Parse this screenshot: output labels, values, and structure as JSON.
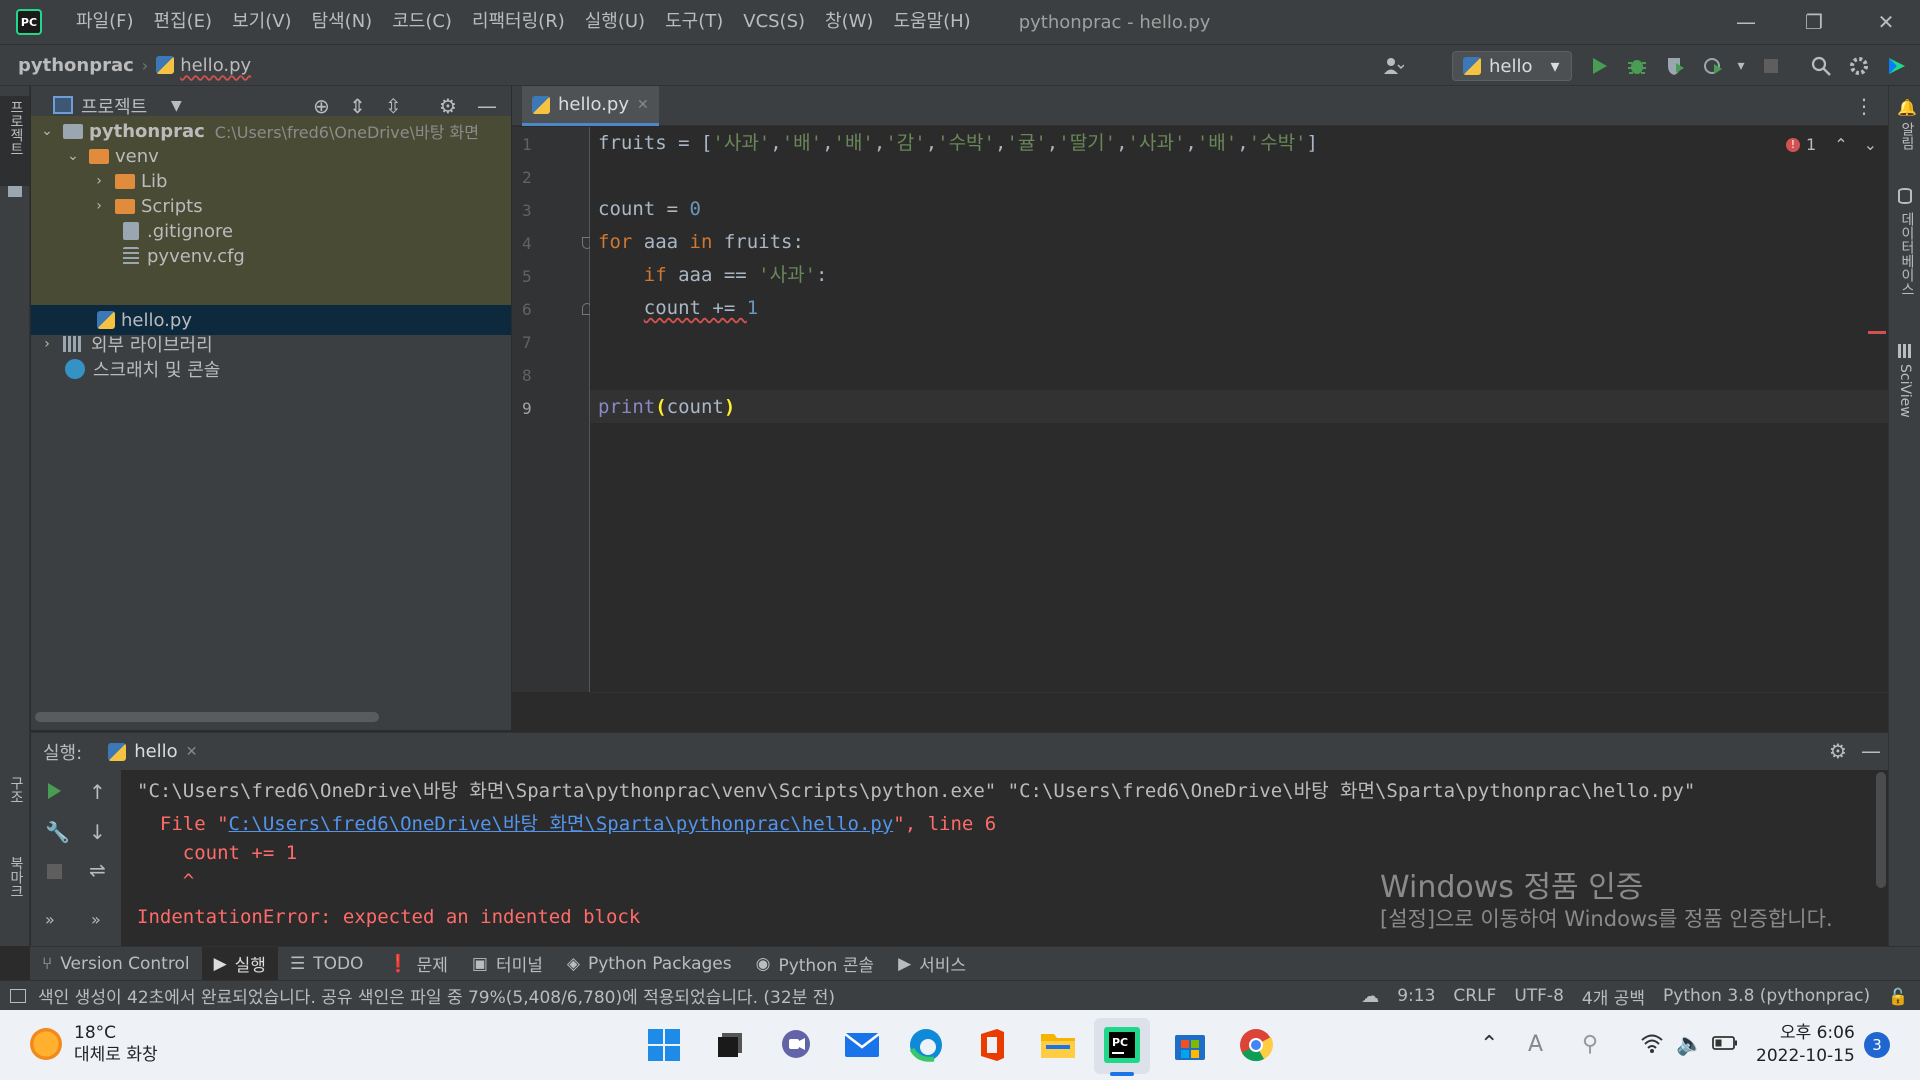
{
  "app": {
    "logo": "PC",
    "window_title": "pythonprac - hello.py"
  },
  "menu": [
    "파일(F)",
    "편집(E)",
    "보기(V)",
    "탐색(N)",
    "코드(C)",
    "리팩터링(R)",
    "실행(U)",
    "도구(T)",
    "VCS(S)",
    "창(W)",
    "도움말(H)"
  ],
  "window_controls": {
    "minimize": "—",
    "restore": "❐",
    "close": "✕"
  },
  "navbar": {
    "project": "pythonprac",
    "separator": "›",
    "file": "hello.py",
    "run_config": "hello",
    "run_config_arrow": "▾"
  },
  "left_strip": {
    "project_label": "프로젝트",
    "structure_label": "구조",
    "bookmarks_label": "북마크"
  },
  "right_strip": {
    "notifications_label": "알림",
    "database_label": "데이터베이스",
    "sciview_label": "SciView"
  },
  "project_panel": {
    "title": "프로젝트",
    "tree": [
      {
        "label": "pythonprac",
        "path": "C:\\Users\\fred6\\OneDrive\\바탕 화면",
        "chev": "⌄",
        "icon": "folder"
      },
      {
        "label": "venv",
        "chev": "⌄",
        "icon": "folder"
      },
      {
        "label": "Lib",
        "chev": "›",
        "icon": "folder"
      },
      {
        "label": "Scripts",
        "chev": "›",
        "icon": "folder"
      },
      {
        "label": ".gitignore",
        "icon": "file"
      },
      {
        "label": "pyvenv.cfg",
        "icon": "file"
      },
      {
        "label": "hello.py",
        "icon": "python"
      },
      {
        "label": "외부 라이브러리",
        "chev": "›",
        "icon": "library"
      },
      {
        "label": "스크래치 및 콘솔",
        "icon": "scratch"
      }
    ]
  },
  "editor": {
    "tab_label": "hello.py",
    "tab_close": "✕",
    "line_numbers": [
      "1",
      "2",
      "3",
      "4",
      "5",
      "6",
      "7",
      "8",
      "9"
    ],
    "error_count": "1",
    "lines": {
      "l1_var": "fruits",
      "l1_op": " = [",
      "l1_items": [
        "'사과'",
        "'배'",
        "'배'",
        "'감'",
        "'수박'",
        "'귤'",
        "'딸기'",
        "'사과'",
        "'배'",
        "'수박'"
      ],
      "l1_end": "]",
      "l3_var": "count",
      "l3_op": " = ",
      "l3_num": "0",
      "l4_kw1": "for",
      "l4_mid": " aaa ",
      "l4_kw2": "in",
      "l4_end": " fruits:",
      "l5_indent": "    ",
      "l5_kw": "if",
      "l5_mid": " aaa == ",
      "l5_str": "'사과'",
      "l5_end": ":",
      "l6_indent": "    ",
      "l6_text": "count += ",
      "l6_num": "1",
      "l9_fn": "print",
      "l9_open": "(",
      "l9_arg": "count",
      "l9_close": ")"
    }
  },
  "run_panel": {
    "label": "실행:",
    "tab": "hello",
    "tab_close": "✕",
    "console": {
      "cmd": "\"C:\\Users\\fred6\\OneDrive\\바탕 화면\\Sparta\\pythonprac\\venv\\Scripts\\python.exe\" \"C:\\Users\\fred6\\OneDrive\\바탕 화면\\Sparta\\pythonprac\\hello.py\"",
      "file_prefix": "  File \"",
      "file_link": "C:\\Users\\fred6\\OneDrive\\바탕 화면\\Sparta\\pythonprac\\hello.py",
      "file_suffix": "\", line 6",
      "code_line": "    count += 1",
      "caret": "    ^",
      "error": "IndentationError: expected an indented block"
    }
  },
  "watermark": {
    "title": "Windows 정품 인증",
    "text": "[설정]으로 이동하여 Windows를 정품 인증합니다."
  },
  "tool_windows": [
    {
      "label": "Version Control",
      "icon": "⑂"
    },
    {
      "label": "실행",
      "icon": "▶",
      "active": true
    },
    {
      "label": "TODO",
      "icon": "☰"
    },
    {
      "label": "문제",
      "icon": "❗"
    },
    {
      "label": "터미널",
      "icon": "▣"
    },
    {
      "label": "Python Packages",
      "icon": "◈"
    },
    {
      "label": "Python 콘솔",
      "icon": "◉"
    },
    {
      "label": "서비스",
      "icon": "▶"
    }
  ],
  "status": {
    "message": "색인 생성이 42초에서 완료되었습니다. 공유 색인은 파일 중 79%(5,408/6,780)에 적용되었습니다. (32분 전)",
    "position": "9:13",
    "line_ending": "CRLF",
    "encoding": "UTF-8",
    "indent": "4개 공백",
    "interpreter": "Python 3.8 (pythonprac)"
  },
  "taskbar": {
    "temperature": "18°C",
    "weather": "대체로 화창",
    "time": "오후 6:06",
    "date": "2022-10-15",
    "notifications": "3"
  },
  "colors": {
    "ide_bg": "#2b2b2b",
    "panel_bg": "#3c3f41",
    "selection": "#0d293e",
    "keyword": "#cc7832",
    "string": "#6a8759",
    "number": "#6897bb",
    "error": "#ff6b68",
    "run_green": "#499c54"
  }
}
